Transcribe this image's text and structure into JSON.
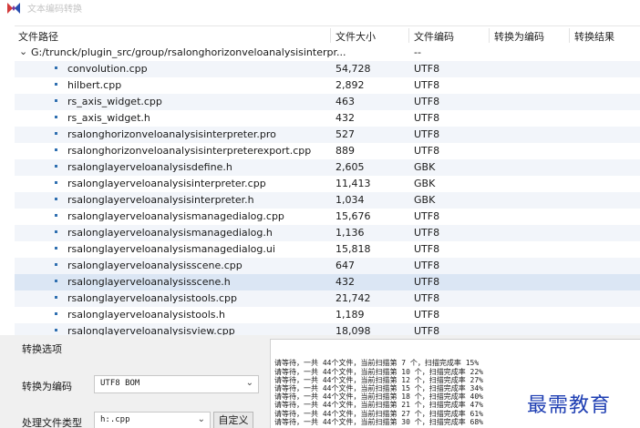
{
  "window": {
    "title": "文本编码转换",
    "icon": "app-logo-icon"
  },
  "tree": {
    "columns": [
      "文件路径",
      "文件大小",
      "文件编码",
      "转换为编码",
      "转换结果"
    ],
    "root": {
      "path": "G:/trunck/plugin_src/group/rsalonghorizonveloanalysisinterpr...",
      "encoding": "--",
      "expanded": true
    },
    "files": [
      {
        "name": "convolution.cpp",
        "size": "54,728",
        "encoding": "UTF8"
      },
      {
        "name": "hilbert.cpp",
        "size": "2,892",
        "encoding": "UTF8"
      },
      {
        "name": "rs_axis_widget.cpp",
        "size": "463",
        "encoding": "UTF8"
      },
      {
        "name": "rs_axis_widget.h",
        "size": "432",
        "encoding": "UTF8"
      },
      {
        "name": "rsalonghorizonveloanalysisinterpreter.pro",
        "size": "527",
        "encoding": "UTF8"
      },
      {
        "name": "rsalonghorizonveloanalysisinterpreterexport.cpp",
        "size": "889",
        "encoding": "UTF8"
      },
      {
        "name": "rsalonglayerveloanalysisdefine.h",
        "size": "2,605",
        "encoding": "GBK"
      },
      {
        "name": "rsalonglayerveloanalysisinterpreter.cpp",
        "size": "11,413",
        "encoding": "GBK"
      },
      {
        "name": "rsalonglayerveloanalysisinterpreter.h",
        "size": "1,034",
        "encoding": "GBK"
      },
      {
        "name": "rsalonglayerveloanalysismanagedialog.cpp",
        "size": "15,676",
        "encoding": "UTF8"
      },
      {
        "name": "rsalonglayerveloanalysismanagedialog.h",
        "size": "1,136",
        "encoding": "UTF8"
      },
      {
        "name": "rsalonglayerveloanalysismanagedialog.ui",
        "size": "15,818",
        "encoding": "UTF8"
      },
      {
        "name": "rsalonglayerveloanalysisscene.cpp",
        "size": "647",
        "encoding": "UTF8"
      },
      {
        "name": "rsalonglayerveloanalysisscene.h",
        "size": "432",
        "encoding": "UTF8",
        "selected": true
      },
      {
        "name": "rsalonglayerveloanalysistools.cpp",
        "size": "21,742",
        "encoding": "UTF8"
      },
      {
        "name": "rsalonglayerveloanalysistools.h",
        "size": "1,189",
        "encoding": "UTF8"
      },
      {
        "name": "rsalonglayerveloanalysisview.cpp",
        "size": "18,098",
        "encoding": "UTF8"
      }
    ]
  },
  "options": {
    "group_label": "转换选项",
    "encoding_label": "转换为编码",
    "encoding_value": "UTF8 BOM",
    "filetype_label": "处理文件类型",
    "filetype_value": "h:.cpp",
    "custom_button": "自定义"
  },
  "log": {
    "lines": [
      "请等待，一共 44个文件，当前扫描第 7 个，扫描完成率 15%",
      "请等待，一共 44个文件，当前扫描第 10 个，扫描完成率 22%",
      "请等待，一共 44个文件，当前扫描第 12 个，扫描完成率 27%",
      "请等待，一共 44个文件，当前扫描第 15 个，扫描完成率 34%",
      "请等待，一共 44个文件，当前扫描第 18 个，扫描完成率 40%",
      "请等待，一共 44个文件，当前扫描第 21 个，扫描完成率 47%",
      "请等待，一共 44个文件，当前扫描第 27 个，扫描完成率 61%",
      "请等待，一共 44个文件，当前扫描第 30 个，扫描完成率 68%"
    ]
  },
  "watermark": "最需教育",
  "colors": {
    "row_alt": "#f2f5fa",
    "row_selected": "#dbe6f4",
    "bullet": "#2f6fb0",
    "watermark": "#1f3fb3"
  }
}
